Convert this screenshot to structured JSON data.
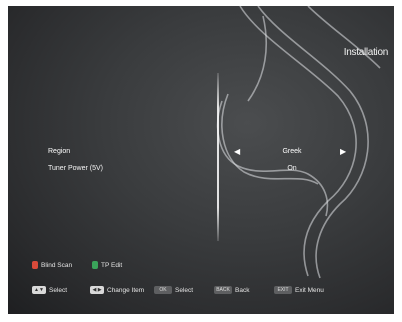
{
  "screen_title": "Installation",
  "settings": [
    {
      "label": "Region",
      "value": "Greek",
      "left_arrow": "◀",
      "right_arrow": "▶"
    },
    {
      "label": "Tuner Power (5V)",
      "value": "On"
    }
  ],
  "hints_top": [
    {
      "key_color": "#d94a3a",
      "label": "Blind Scan"
    },
    {
      "key_color": "#3aa35a",
      "label": "TP Edit"
    }
  ],
  "hints_bottom": [
    {
      "key": "",
      "label": "Select"
    },
    {
      "key": "◀ ▶",
      "label": "Change Item"
    },
    {
      "key": "OK",
      "label": "Select"
    },
    {
      "key": "BACK",
      "label": "Back"
    },
    {
      "key": "EXIT",
      "label": "Exit Menu"
    }
  ]
}
